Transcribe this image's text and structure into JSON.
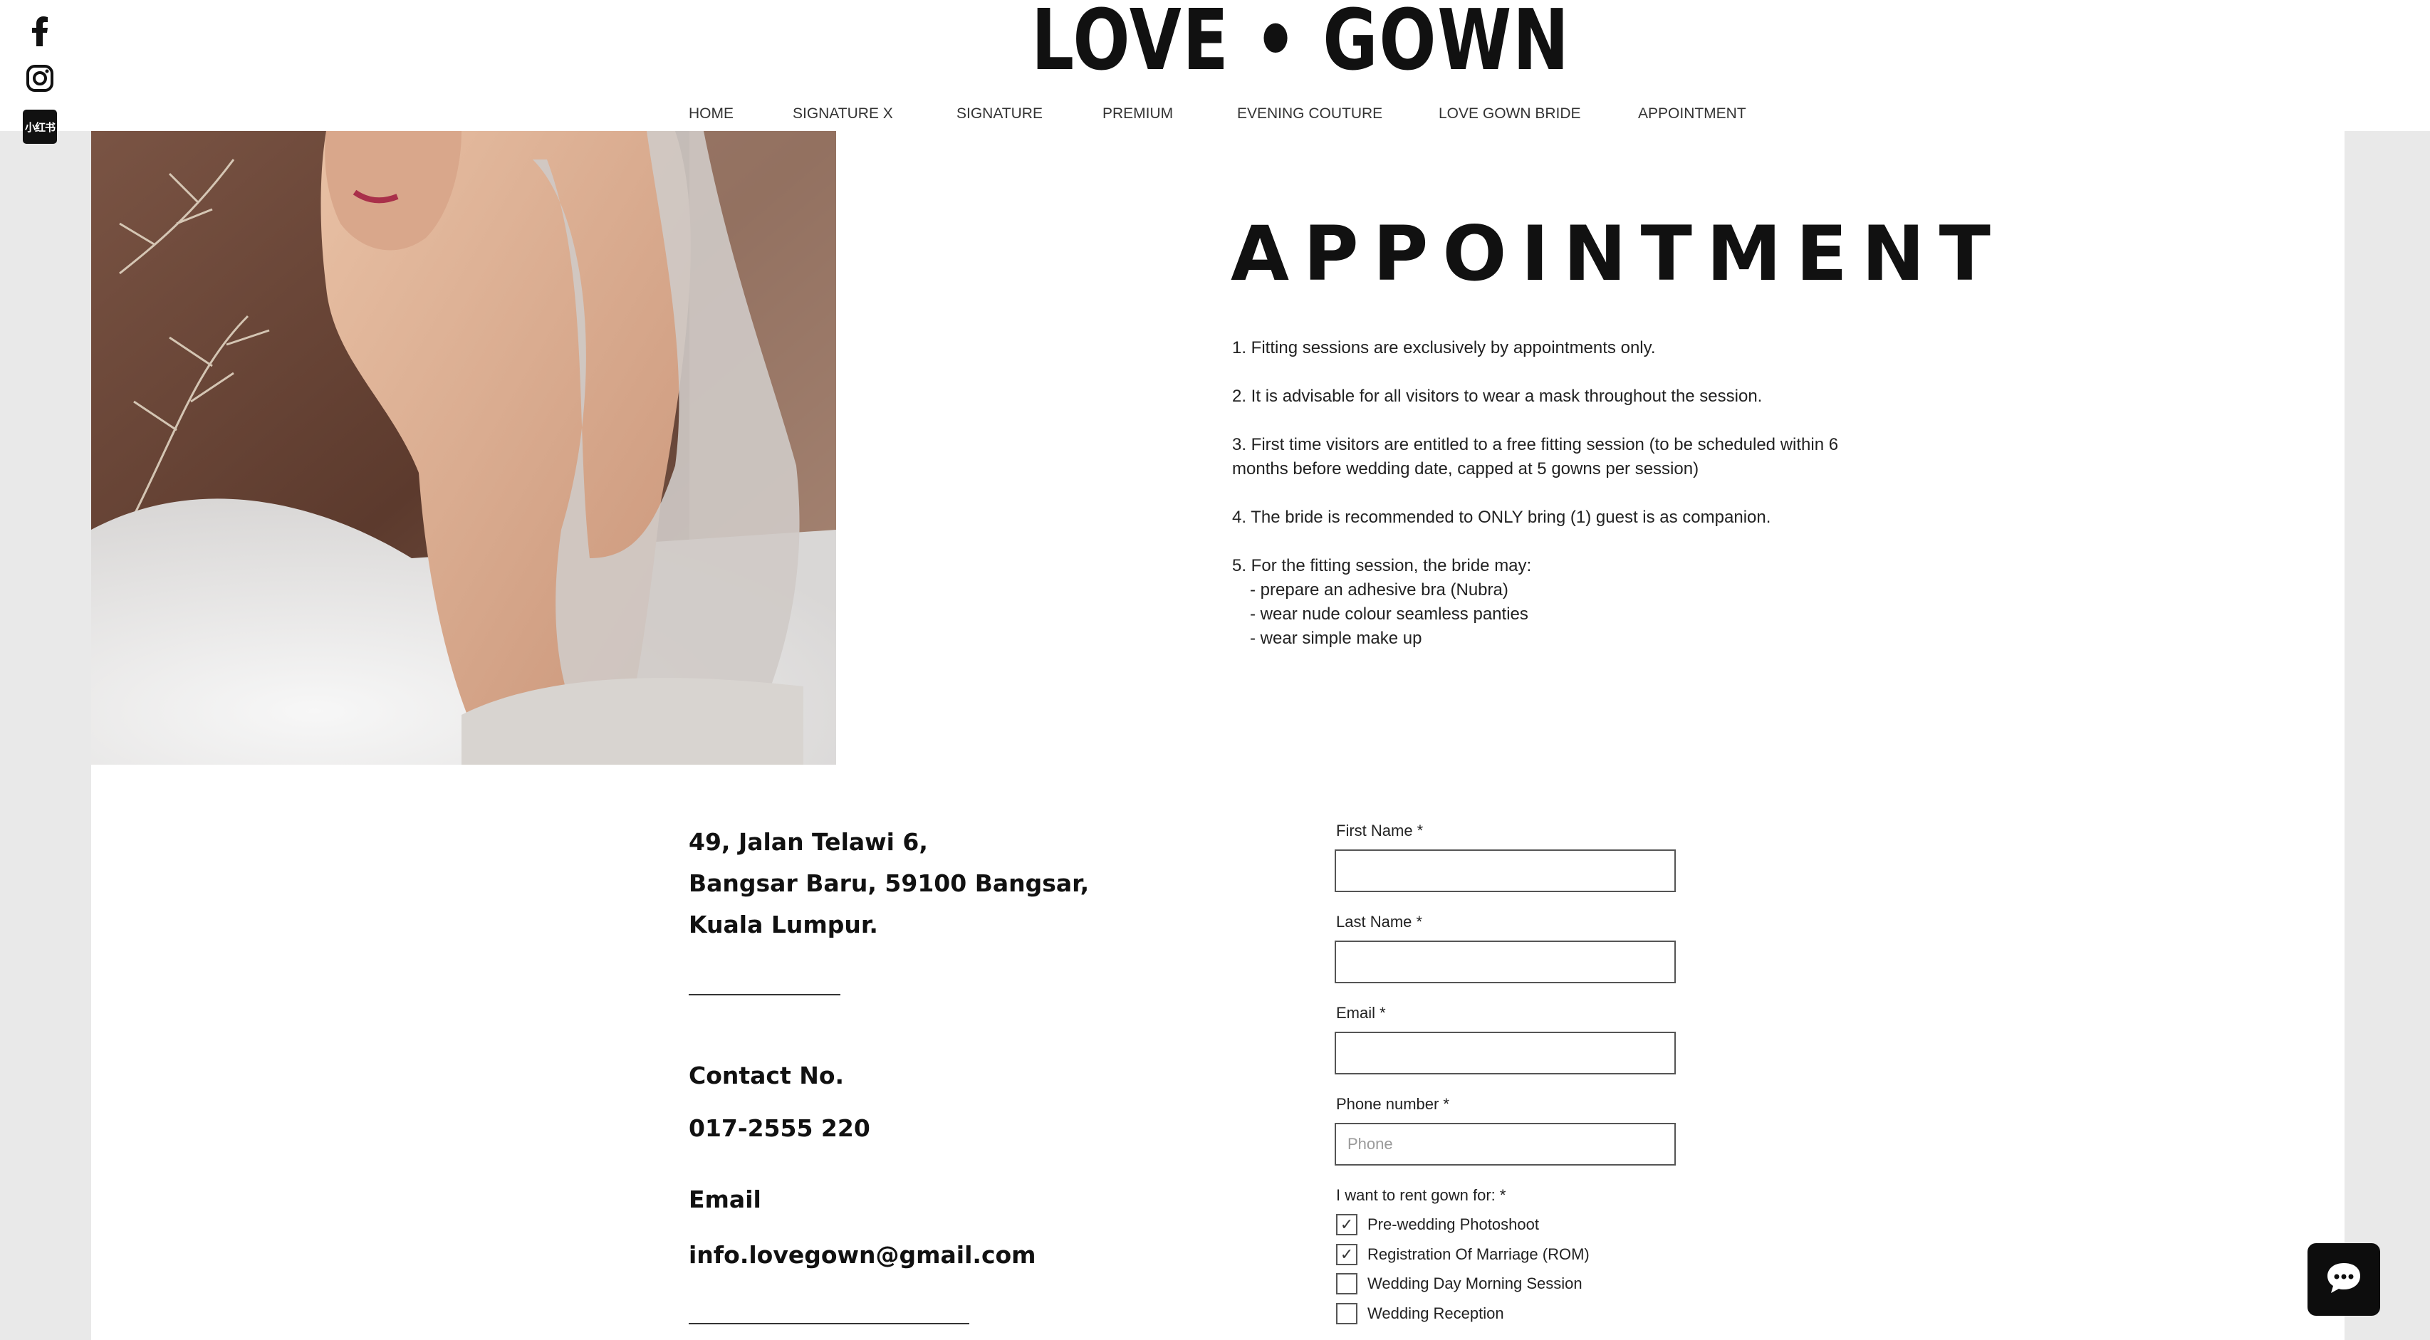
{
  "brand": {
    "logo_text": "LOVE • GOWN"
  },
  "social": [
    {
      "name": "facebook-icon"
    },
    {
      "name": "instagram-icon"
    },
    {
      "name": "xiaohongshu-icon",
      "label": "小红书"
    }
  ],
  "nav": {
    "items": [
      {
        "label": "HOME"
      },
      {
        "label": "SIGNATURE X"
      },
      {
        "label": "SIGNATURE"
      },
      {
        "label": "PREMIUM"
      },
      {
        "label": "EVENING COUTURE"
      },
      {
        "label": "LOVE GOWN BRIDE"
      },
      {
        "label": "APPOINTMENT"
      }
    ]
  },
  "page": {
    "title": "APPOINTMENT",
    "rules": [
      "1. Fitting sessions are exclusively by appointments only.",
      "2. It is advisable for all visitors to wear a mask throughout the session.",
      "3. First time visitors are entitled to a free fitting session (to be scheduled within 6 months before wedding date, capped at 5 gowns per session)",
      "4. The bride is recommended to ONLY bring (1) guest is as companion.",
      "5. For the fitting session, the bride may:"
    ],
    "rule5_items": [
      "- prepare an adhesive bra (Nubra)",
      "- wear nude colour seamless panties",
      "- wear simple make up"
    ]
  },
  "contact": {
    "address_line1": "49, Jalan Telawi 6,",
    "address_line2": "Bangsar Baru, 59100 Bangsar,",
    "address_line3": "Kuala Lumpur.",
    "phone_label": "Contact No.",
    "phone": "017-2555 220",
    "email_label": "Email",
    "email": "info.lovegown@gmail.com"
  },
  "form": {
    "first_name_label": "First Name *",
    "first_name_value": "",
    "last_name_label": "Last Name *",
    "last_name_value": "",
    "email_label": "Email *",
    "email_value": "",
    "phone_label": "Phone number *",
    "phone_placeholder": "Phone",
    "rent_label": "I want to rent gown for: *",
    "options": [
      {
        "label": "Pre-wedding Photoshoot",
        "checked": true
      },
      {
        "label": "Registration Of Marriage (ROM)",
        "checked": true
      },
      {
        "label": "Wedding Day Morning Session",
        "checked": false
      },
      {
        "label": "Wedding Reception",
        "checked": false
      }
    ]
  },
  "colors": {
    "background": "#e9e9e9",
    "panel": "#ffffff",
    "text": "#111111",
    "chat_button": "#0d0d0d"
  }
}
